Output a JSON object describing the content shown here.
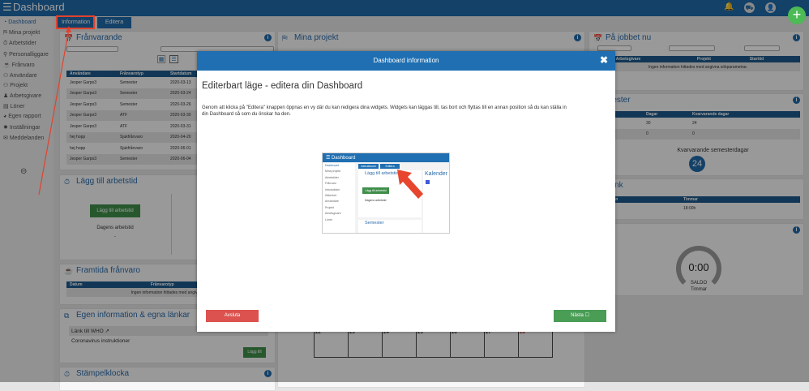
{
  "header": {
    "title": "Dashboard",
    "icons": [
      "bell-icon",
      "cart-icon",
      "user-icon"
    ],
    "add": "+"
  },
  "sidebar": {
    "items": [
      {
        "label": "Dashboard",
        "icon": "dashboard-icon"
      },
      {
        "label": "Mina projekt",
        "icon": "projects-icon"
      },
      {
        "label": "Arbetstider",
        "icon": "stopwatch-icon"
      },
      {
        "label": "Personalliggare",
        "icon": "pin-icon"
      },
      {
        "label": "Frånvaro",
        "icon": "cup-icon"
      },
      {
        "label": "Användare",
        "icon": "users-icon"
      },
      {
        "label": "Projekt",
        "icon": "project-icon"
      },
      {
        "label": "Arbetsgivare",
        "icon": "employer-icon"
      },
      {
        "label": "Löner",
        "icon": "salary-icon"
      },
      {
        "label": "Egen rapport",
        "icon": "report-icon"
      },
      {
        "label": "Inställningar",
        "icon": "gear-icon"
      },
      {
        "label": "Meddelanden",
        "icon": "mail-icon"
      }
    ]
  },
  "tabs": {
    "information": "Information",
    "editera": "Editera"
  },
  "franvarande": {
    "title": "Frånvarande",
    "columns": [
      "Användare",
      "Frånvarotyp",
      "Startdatum"
    ],
    "rows": [
      [
        "Jesper Garpo3",
        "Semester",
        "2020-03-13"
      ],
      [
        "Jesper Garpo3",
        "Semester",
        "2020-03-24"
      ],
      [
        "Jesper Garpo3",
        "Semester",
        "2020-03-26"
      ],
      [
        "Jesper Garpo3",
        "ATF",
        "2020-03-30"
      ],
      [
        "Jesper Garpo3",
        "ATF",
        "2020-03-31"
      ],
      [
        "hej hopp",
        "Sjukfrånvaro",
        "2020-04-20"
      ],
      [
        "hej hopp",
        "Sjukfrånvaro",
        "2020-06-01"
      ],
      [
        "Jesper Garpo3",
        "Semester",
        "2020-06-04"
      ]
    ]
  },
  "lagg_till": {
    "title": "Lägg till arbetstid",
    "button": "Lägg till arbetstid",
    "label": "Dagens arbetstid",
    "value": "-"
  },
  "framtida": {
    "title": "Framtida frånvaro",
    "columns": [
      "Datum",
      "Frånvarotyp"
    ],
    "empty": "Ingen information hittades med angivna sök"
  },
  "egen": {
    "title": "Egen information & egna länkar",
    "link": "Länk till WHO",
    "text": "Coronavirus instruktioner",
    "button": "Lägg till"
  },
  "stampel": {
    "title": "Stämpelklocka"
  },
  "mina_projekt": {
    "title": "Mina projekt"
  },
  "calendar": {
    "days": [
      "22",
      "23",
      "24",
      "25",
      "26",
      "27",
      "28"
    ]
  },
  "pa_jobbet": {
    "title": "På jobbet nu",
    "columns": [
      "Arbetsgivare",
      "Projekt",
      "Starttid"
    ],
    "empty": "Ingen information hittades med angivna sökparametrar."
  },
  "semester": {
    "title": "mester",
    "columns": [
      "Dagar",
      "Kvarvarande dagar"
    ],
    "rows": [
      [
        "30",
        "24"
      ],
      [
        "0",
        "0"
      ]
    ],
    "remaining_label": "Kvarvarande semesterdagar",
    "remaining": "24"
  },
  "bank": {
    "title": "bank",
    "columns": [
      "ens namn",
      "Timmar"
    ],
    "value": "18:00h"
  },
  "saldo": {
    "title": "do",
    "value": "0:00",
    "label": "SALDO",
    "unit": "Timmar"
  },
  "modal": {
    "title": "Dashboard information",
    "heading": "Editerbart läge - editera din Dashboard",
    "body": "Genom att klicka på \"Editera\" knappen öppnas en vy där du kan redigera dina widgets. Widgets kan läggas till, tas bort och flyttas till en annan position så du kan ställa in din Dashboard så som du önskar ha den.",
    "cancel": "Avsluta",
    "next": "Nästa ☐",
    "preview": {
      "title": "Dashboard",
      "tab1": "Instruktioner",
      "tab2": "Editera",
      "nav": [
        "Dashboard",
        "Mina projekt",
        "Arbetstider",
        "Frånvaro",
        "Introduktion",
        "Säkerhet",
        "Användare",
        "Projekt",
        "Arbetsgivare",
        "Löner"
      ],
      "widget1": "Lägg till arbetstid",
      "button": "Lägg till arbetstid",
      "label": "Dagens arbetstid",
      "widget2": "Kalender",
      "widget3": "Semester"
    }
  }
}
